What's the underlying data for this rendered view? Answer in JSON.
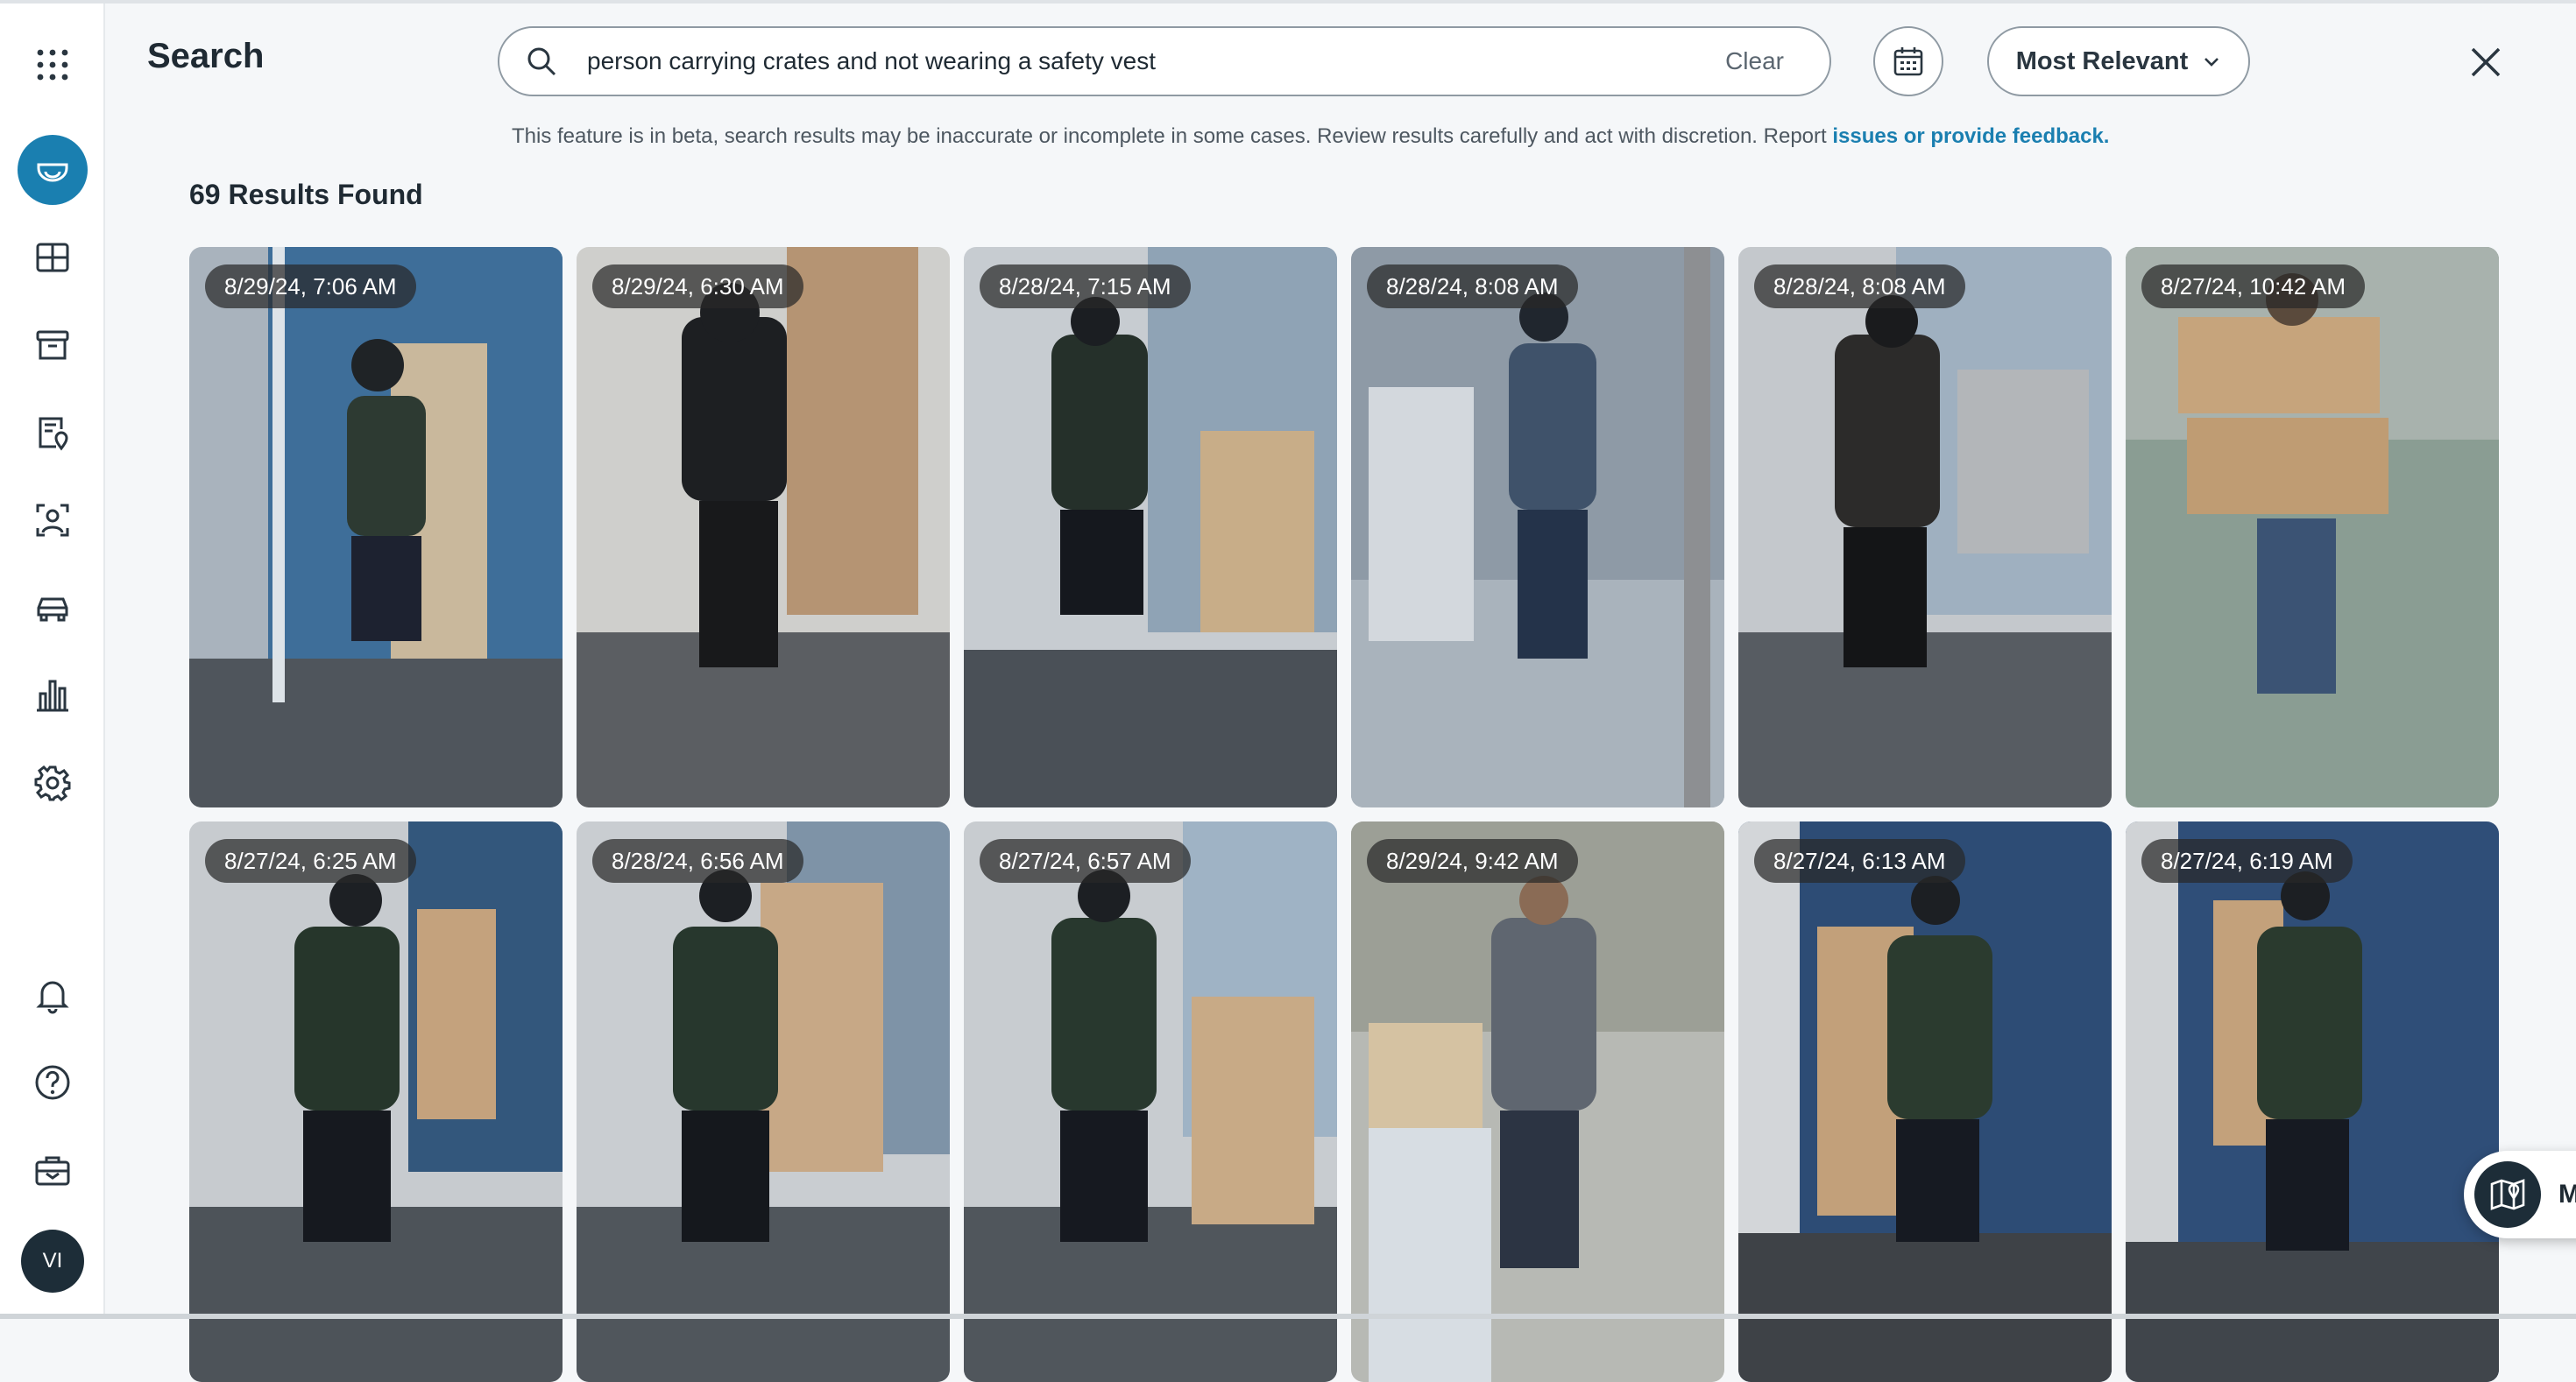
{
  "app": {
    "title": "Search",
    "user_initials": "VI"
  },
  "sidebar": {
    "items": [
      {
        "icon": "camera-dome-icon",
        "active": true
      },
      {
        "icon": "grid-icon"
      },
      {
        "icon": "archive-icon"
      },
      {
        "icon": "report-location-icon"
      },
      {
        "icon": "person-scan-icon"
      },
      {
        "icon": "vehicle-icon"
      },
      {
        "icon": "analytics-icon"
      },
      {
        "icon": "gear-icon"
      },
      {
        "icon": "bell-icon"
      },
      {
        "icon": "help-icon"
      },
      {
        "icon": "toolbox-icon"
      }
    ]
  },
  "search": {
    "query": "person carrying crates and not wearing a safety vest",
    "clear_label": "Clear",
    "sort_label": "Most Relevant"
  },
  "notice": {
    "text": "This feature is in beta, search results may be inaccurate or incomplete in some cases. Review results carefully and act with discretion. Report ",
    "link": "issues or provide feedback."
  },
  "results": {
    "count_label": "69 Results Found",
    "items": [
      {
        "timestamp": "8/29/24, 7:06 AM"
      },
      {
        "timestamp": "8/29/24, 6:30 AM"
      },
      {
        "timestamp": "8/28/24, 7:15 AM"
      },
      {
        "timestamp": "8/28/24, 8:08 AM"
      },
      {
        "timestamp": "8/28/24, 8:08 AM"
      },
      {
        "timestamp": "8/27/24, 10:42 AM"
      },
      {
        "timestamp": "8/27/24, 6:25 AM"
      },
      {
        "timestamp": "8/28/24, 6:56 AM"
      },
      {
        "timestamp": "8/27/24, 6:57 AM"
      },
      {
        "timestamp": "8/29/24, 9:42 AM"
      },
      {
        "timestamp": "8/27/24, 6:13 AM"
      },
      {
        "timestamp": "8/27/24, 6:19 AM"
      }
    ]
  },
  "map": {
    "label": "Map"
  },
  "colors": {
    "accent": "#1a7fb0",
    "sidebar_bg": "#ffffff",
    "dark": "#1d2d38"
  }
}
